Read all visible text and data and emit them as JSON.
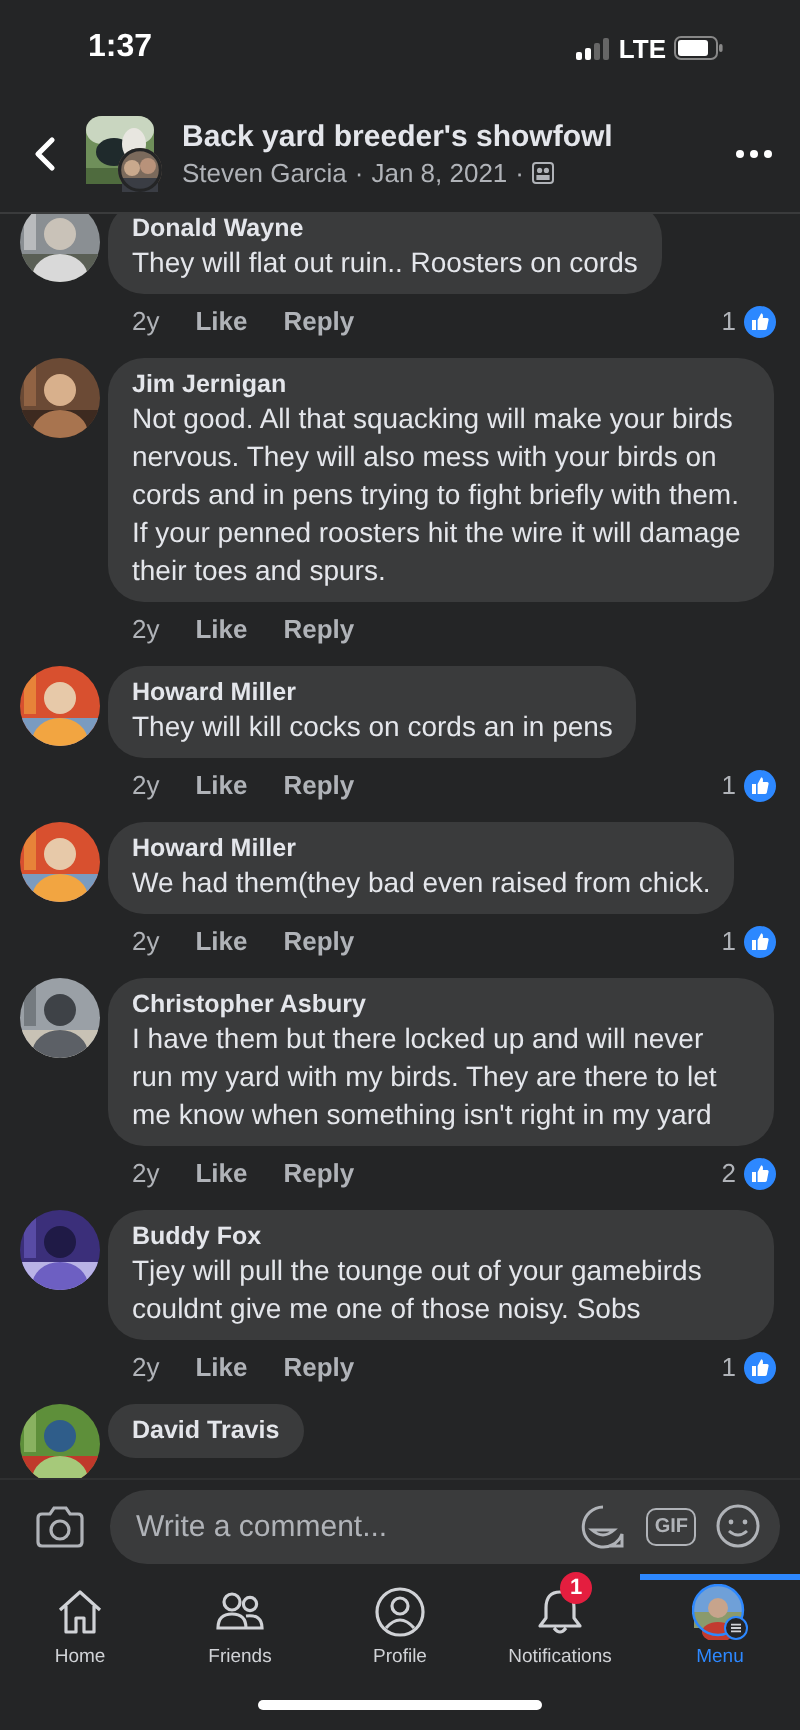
{
  "status_bar": {
    "time": "1:37",
    "network": "LTE"
  },
  "header": {
    "title": "Back yard breeder's showfowl",
    "author": "Steven Garcia",
    "date": "Jan 8, 2021",
    "separator": "·"
  },
  "comments": [
    {
      "name": "Donald Wayne",
      "text": "They will flat out ruin.. Roosters on cords",
      "age": "2y",
      "like": "Like",
      "reply": "Reply",
      "likes": "1"
    },
    {
      "name": "Jim Jernigan",
      "text": "Not good.  All that squacking will make your birds nervous.  They will also mess with your birds on cords and in pens trying to fight briefly with them.  If your penned roosters hit the wire it will damage their toes and spurs.",
      "age": "2y",
      "like": "Like",
      "reply": "Reply"
    },
    {
      "name": "Howard Miller",
      "text": "They will kill cocks on cords an in pens",
      "age": "2y",
      "like": "Like",
      "reply": "Reply",
      "likes": "1"
    },
    {
      "name": "Howard Miller",
      "text": "We had them(they bad even raised from chick.",
      "age": "2y",
      "like": "Like",
      "reply": "Reply",
      "likes": "1"
    },
    {
      "name": "Christopher Asbury",
      "text": "I have them but there locked up and will never run my yard with my birds. They are there to let me know when something isn't right in my yard",
      "age": "2y",
      "like": "Like",
      "reply": "Reply",
      "likes": "2"
    },
    {
      "name": "Buddy Fox",
      "text": "Tjey will pull the tounge out of your gamebirds couldnt give me one of those noisy. Sobs",
      "age": "2y",
      "like": "Like",
      "reply": "Reply",
      "likes": "1"
    },
    {
      "name": "David Travis"
    }
  ],
  "composer": {
    "placeholder": "Write a comment...",
    "gif": "GIF"
  },
  "tabs": [
    {
      "kind": "home",
      "label": "Home",
      "selected": false
    },
    {
      "kind": "friends",
      "label": "Friends",
      "selected": false
    },
    {
      "kind": "profile",
      "label": "Profile",
      "selected": false
    },
    {
      "kind": "notifications",
      "label": "Notifications",
      "selected": false,
      "badge": "1"
    },
    {
      "kind": "menu",
      "label": "Menu",
      "selected": true
    }
  ]
}
